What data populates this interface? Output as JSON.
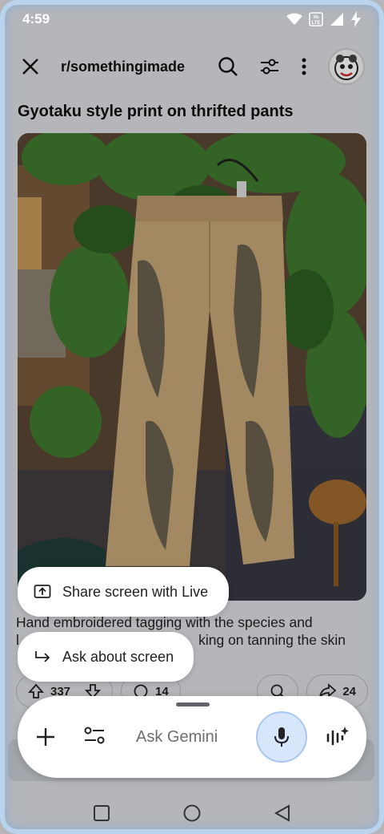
{
  "status_bar": {
    "time": "4:59"
  },
  "header": {
    "subreddit": "r/somethingimade"
  },
  "post": {
    "title": "Gyotaku style print on thrifted pants",
    "body_line1": "Hand embroidered tagging with the species and",
    "body_line2_left": "l",
    "body_line2_right": "king on tanning the skin",
    "upvotes": "337",
    "comments": "14",
    "shares": "24"
  },
  "overlay": {
    "share_screen_label": "Share screen with Live",
    "ask_screen_label": "Ask about screen",
    "gemini_placeholder": "Ask Gemini"
  },
  "colors": {
    "frame": "#b9d3ee",
    "mic_bg": "#d7e6fb",
    "pants": "#c7a878",
    "leaf": "#3f7a2e"
  },
  "icons": [
    "close-icon",
    "search-icon",
    "filter-icon",
    "more-icon",
    "upvote-icon",
    "downvote-icon",
    "comment-icon",
    "award-icon",
    "share-icon",
    "plus-icon",
    "tune-icon",
    "mic-icon",
    "live-icon",
    "screen-share-icon",
    "arrow-return-icon"
  ]
}
